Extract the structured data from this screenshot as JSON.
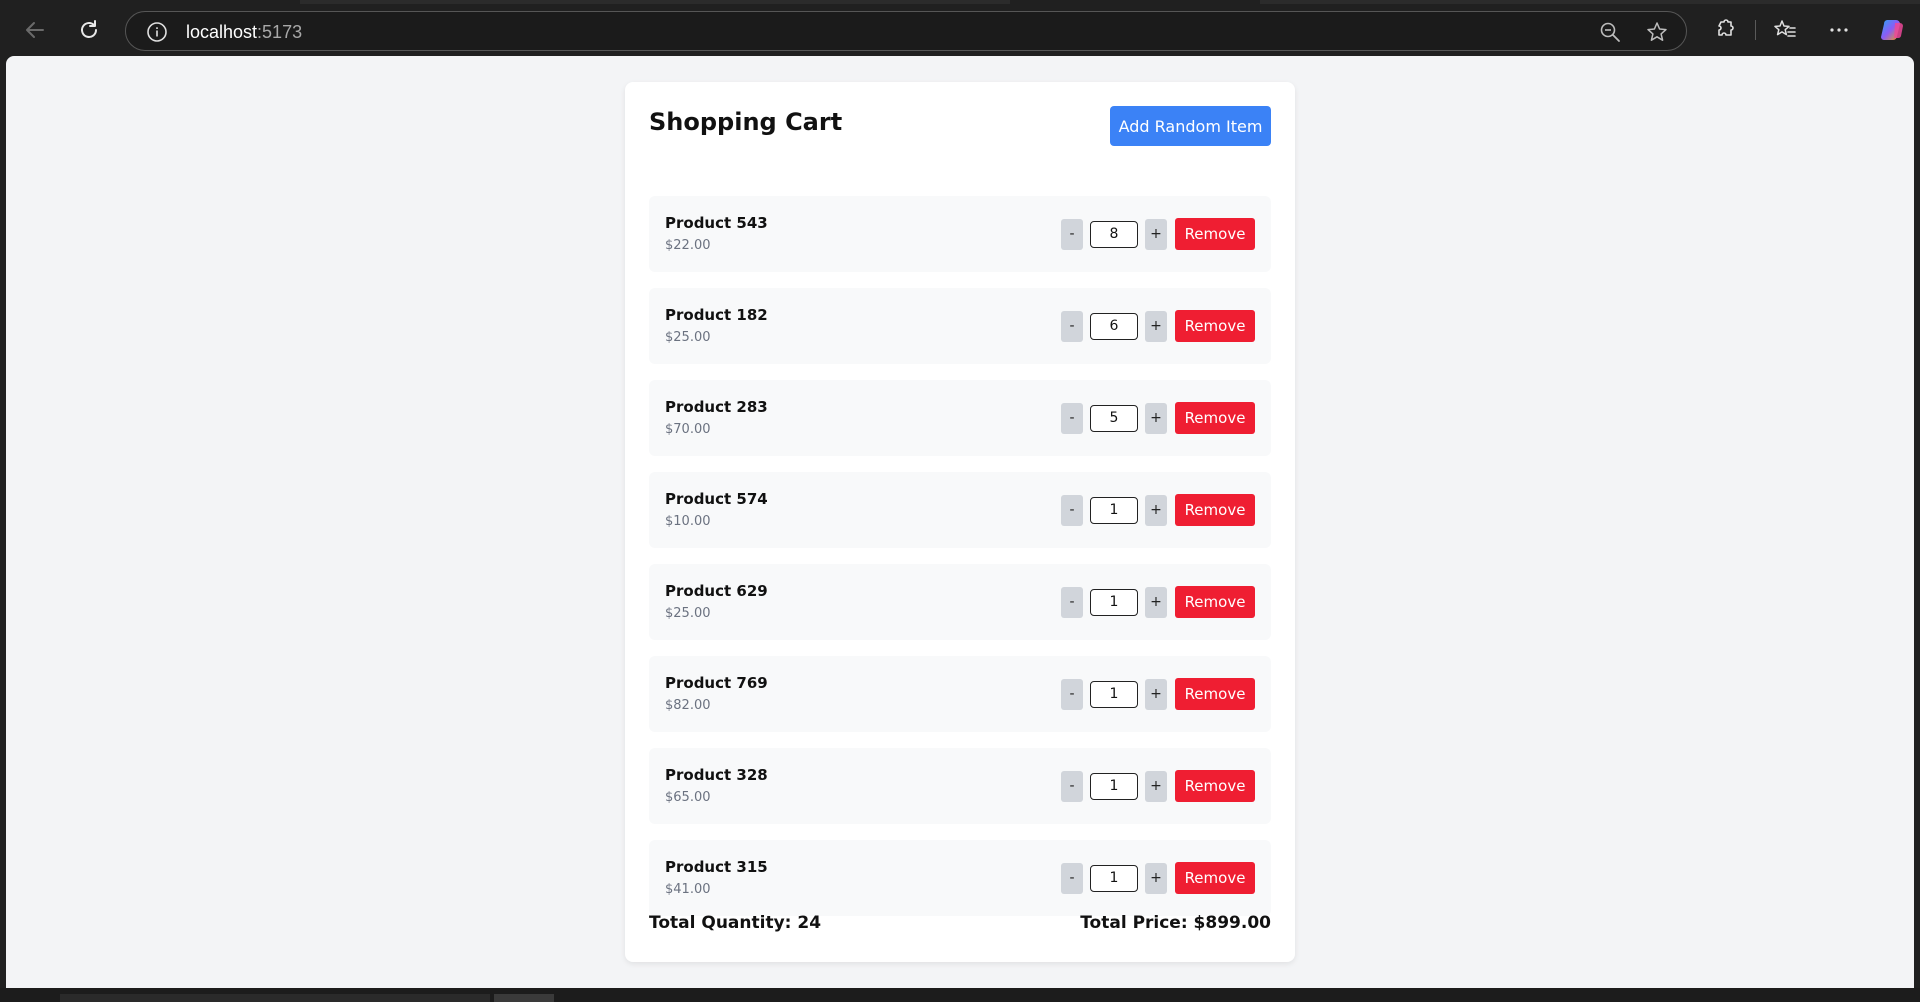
{
  "browser": {
    "url_host": "localhost",
    "url_port": ":5173"
  },
  "cart": {
    "title": "Shopping Cart",
    "add_button_label": "Add Random Item",
    "decrement_label": "-",
    "increment_label": "+",
    "remove_label": "Remove",
    "items": [
      {
        "name": "Product 543",
        "price": "$22.00",
        "quantity": "8"
      },
      {
        "name": "Product 182",
        "price": "$25.00",
        "quantity": "6"
      },
      {
        "name": "Product 283",
        "price": "$70.00",
        "quantity": "5"
      },
      {
        "name": "Product 574",
        "price": "$10.00",
        "quantity": "1"
      },
      {
        "name": "Product 629",
        "price": "$25.00",
        "quantity": "1"
      },
      {
        "name": "Product 769",
        "price": "$82.00",
        "quantity": "1"
      },
      {
        "name": "Product 328",
        "price": "$65.00",
        "quantity": "1"
      },
      {
        "name": "Product 315",
        "price": "$41.00",
        "quantity": "1"
      }
    ],
    "total_quantity": "Total Quantity: 24",
    "total_price": "Total Price: $899.00"
  },
  "colors": {
    "primary": "#3b82f6",
    "danger": "#ef1e32",
    "page_bg": "#f3f4f6",
    "item_bg": "#f8f9fa"
  },
  "icons": {
    "back": "back-arrow-icon",
    "reload": "reload-icon",
    "site_info": "info-icon",
    "zoom": "zoom-out-icon",
    "favorite": "star-icon",
    "extensions": "puzzle-icon",
    "favorites_bar": "favorites-icon",
    "menu": "more-icon",
    "copilot": "copilot-icon"
  }
}
